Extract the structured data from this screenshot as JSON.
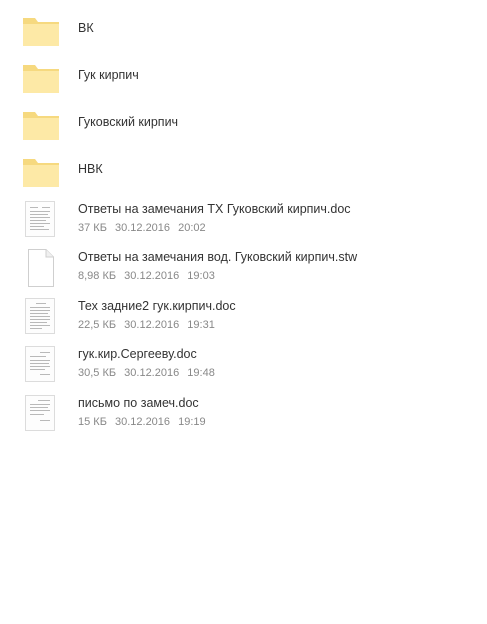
{
  "folders": [
    {
      "name": "ВК",
      "icon": "folder-icon"
    },
    {
      "name": "Гук кирпич",
      "icon": "folder-icon"
    },
    {
      "name": "Гуковский кирпич",
      "icon": "folder-icon"
    },
    {
      "name": "НВК",
      "icon": "folder-icon"
    }
  ],
  "files": [
    {
      "name": "Ответы на замечания ТХ Гуковский кирпич.doc",
      "size": "37 КБ",
      "date": "30.12.2016",
      "time": "20:02",
      "icon": "document-thumbnail-icon"
    },
    {
      "name": "Ответы на замечания вод. Гуковский кирпич.stw",
      "size": "8,98 КБ",
      "date": "30.12.2016",
      "time": "19:03",
      "icon": "blank-file-icon"
    },
    {
      "name": "Тех задние2 гук.кирпич.doc",
      "size": "22,5 КБ",
      "date": "30.12.2016",
      "time": "19:31",
      "icon": "document-thumbnail-icon"
    },
    {
      "name": "гук.кир.Сергееву.doc",
      "size": "30,5 КБ",
      "date": "30.12.2016",
      "time": "19:48",
      "icon": "document-thumbnail-icon"
    },
    {
      "name": "письмо по замеч.doc",
      "size": "15 КБ",
      "date": "30.12.2016",
      "time": "19:19",
      "icon": "document-thumbnail-icon"
    }
  ],
  "colors": {
    "folder_fill": "#fde9a6",
    "folder_tab": "#f7dc86",
    "name_text": "#333333",
    "meta_text": "#888888"
  }
}
